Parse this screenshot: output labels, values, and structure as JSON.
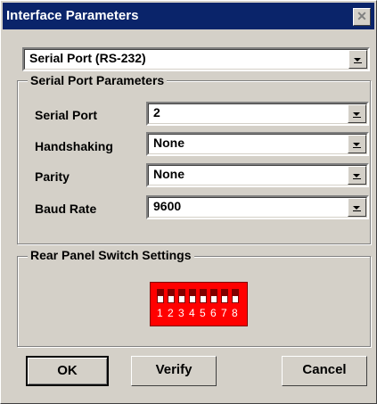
{
  "window": {
    "title": "Interface Parameters"
  },
  "interface_type": {
    "value": "Serial Port (RS-232)"
  },
  "serial_group": {
    "label": "Serial Port Parameters",
    "rows": [
      {
        "label": "Serial Port",
        "value": "2"
      },
      {
        "label": "Handshaking",
        "value": "None"
      },
      {
        "label": "Parity",
        "value": "None"
      },
      {
        "label": "Baud Rate",
        "value": "9600"
      }
    ]
  },
  "rear_panel": {
    "label": "Rear Panel Switch Settings",
    "switch_numbers": [
      "1",
      "2",
      "3",
      "4",
      "5",
      "6",
      "7",
      "8"
    ],
    "switch_color": "#ff0000"
  },
  "buttons": {
    "ok": "OK",
    "verify": "Verify",
    "cancel": "Cancel"
  },
  "colors": {
    "titlebar": "#0a246a",
    "face": "#d4d0c8"
  }
}
